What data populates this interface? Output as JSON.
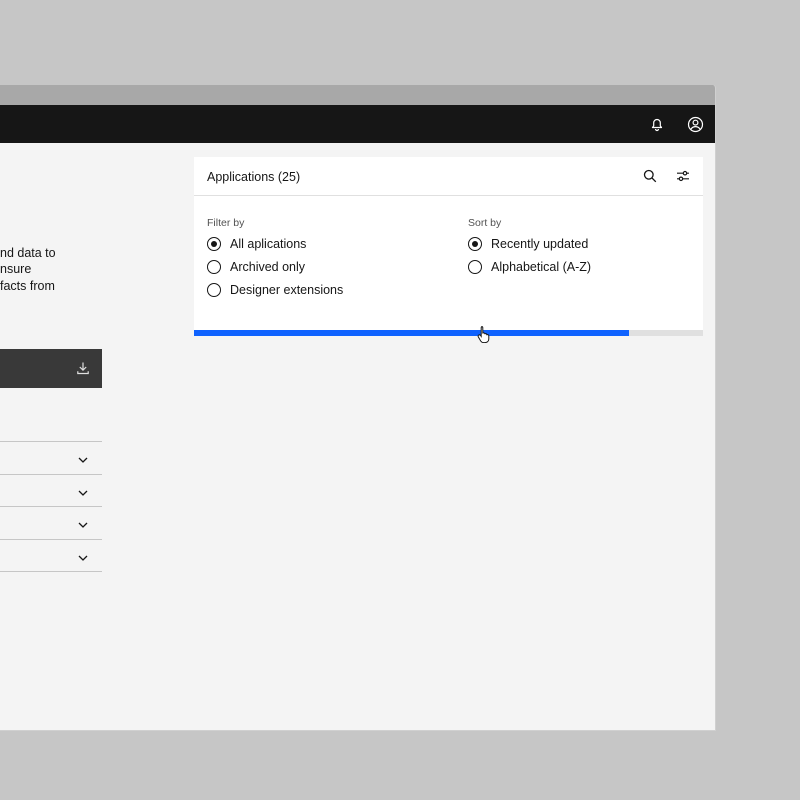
{
  "description": {
    "lines": [
      "nd data to",
      "nsure",
      "facts from"
    ]
  },
  "panel": {
    "title": "Applications (25)",
    "filter": {
      "label": "Filter by",
      "options": [
        {
          "label": "All aplications",
          "checked": true
        },
        {
          "label": "Archived only",
          "checked": false
        },
        {
          "label": "Designer extensions",
          "checked": false
        }
      ]
    },
    "sort": {
      "label": "Sort by",
      "options": [
        {
          "label": "Recently updated",
          "checked": true
        },
        {
          "label": "Alphabetical (A-Z)",
          "checked": false
        }
      ]
    },
    "progress": 0.855
  },
  "icons": {
    "notification": "bell-icon",
    "user": "user-avatar-icon",
    "search": "search-icon",
    "settings": "sliders-icon",
    "download": "download-icon",
    "chevron": "chevron-down-icon"
  },
  "colors": {
    "accent": "#0f62fe",
    "header": "#161616",
    "background": "#f4f4f4"
  }
}
